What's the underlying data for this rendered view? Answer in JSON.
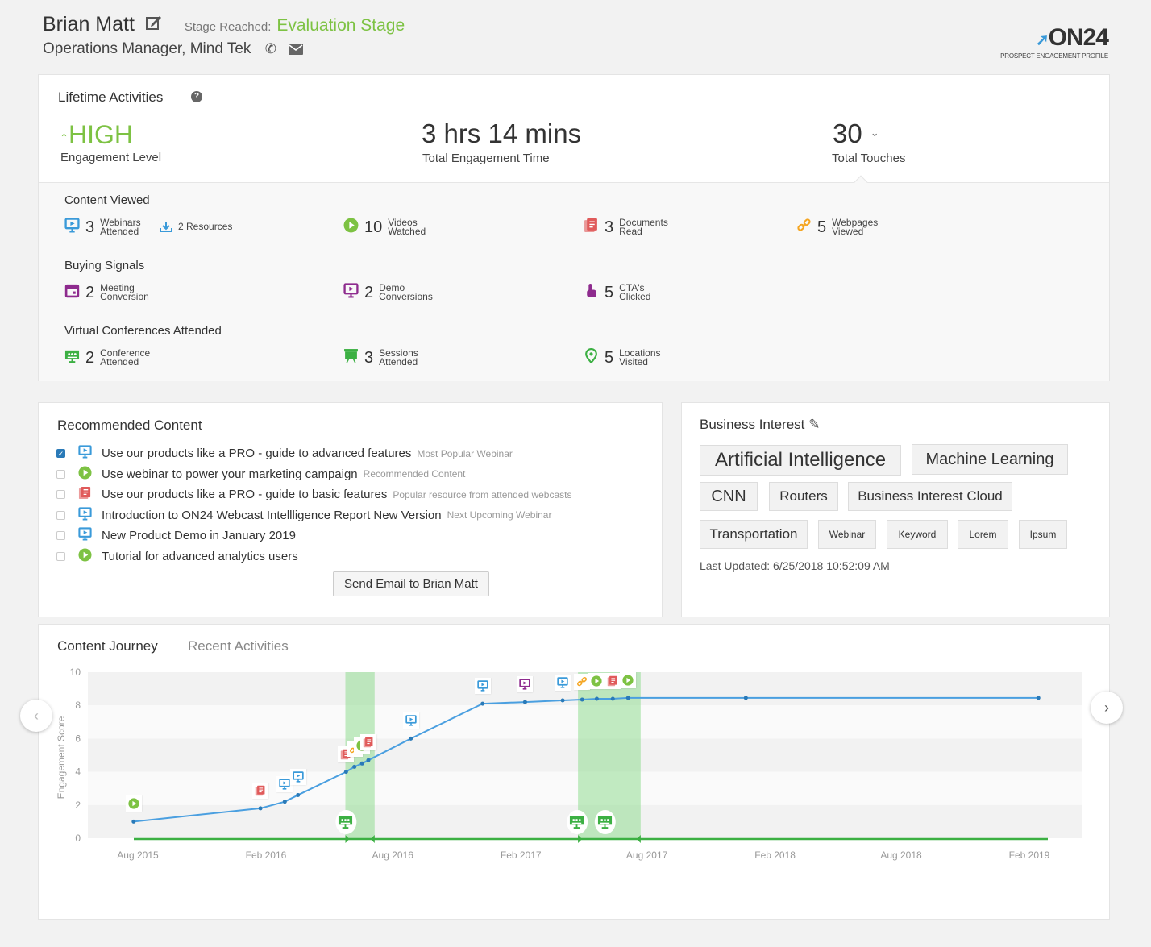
{
  "header": {
    "name": "Brian Matt",
    "stage_label": "Stage Reached:",
    "stage_value": "Evaluation Stage",
    "subtitle": "Operations Manager, Mind Tek",
    "logo_text": "ON24",
    "logo_sub": "PROSPECT ENGAGEMENT PROFILE"
  },
  "lifetime": {
    "title": "Lifetime Activities",
    "level": "HIGH",
    "level_label": "Engagement Level",
    "time": "3 hrs 14 mins",
    "time_label": "Total Engagement Time",
    "touches": "30",
    "touches_label": "Total Touches",
    "content_title": "Content Viewed",
    "buying_title": "Buying Signals",
    "virtual_title": "Virtual Conferences Attended",
    "content": [
      {
        "n": "3",
        "l1": "Webinars",
        "l2": "Attended",
        "icon": "webinar-icon"
      },
      {
        "n": "10",
        "l1": "Videos",
        "l2": "Watched",
        "icon": "video-icon"
      },
      {
        "n": "3",
        "l1": "Documents",
        "l2": "Read",
        "icon": "document-icon"
      },
      {
        "n": "5",
        "l1": "Webpages",
        "l2": "Viewed",
        "icon": "link-icon"
      }
    ],
    "resources": "2 Resources",
    "buying": [
      {
        "n": "2",
        "l1": "Meeting",
        "l2": "Conversion",
        "icon": "calendar-icon"
      },
      {
        "n": "2",
        "l1": "Demo",
        "l2": "Conversions",
        "icon": "demo-icon"
      },
      {
        "n": "5",
        "l1": "CTA's",
        "l2": "Clicked",
        "icon": "pointer-icon"
      }
    ],
    "virtual": [
      {
        "n": "2",
        "l1": "Conference",
        "l2": "Attended",
        "icon": "conference-icon"
      },
      {
        "n": "3",
        "l1": "Sessions",
        "l2": "Attended",
        "icon": "session-icon"
      },
      {
        "n": "5",
        "l1": "Locations",
        "l2": "Visited",
        "icon": "location-icon"
      }
    ]
  },
  "recommended": {
    "title": "Recommended Content",
    "items": [
      {
        "text": "Use our products like a PRO - guide to advanced features",
        "hint": "Most Popular Webinar",
        "icon": "webinar",
        "checked": true
      },
      {
        "text": "Use webinar to power your marketing campaign",
        "hint": "Recommended Content",
        "icon": "video",
        "checked": false
      },
      {
        "text": "Use our products like a PRO - guide to basic features",
        "hint": "Popular resource from attended webcasts",
        "icon": "document",
        "checked": false
      },
      {
        "text": "Introduction to ON24 Webcast Intellligence Report New Version",
        "hint": "Next Upcoming Webinar",
        "icon": "webinar",
        "checked": false
      },
      {
        "text": "New Product Demo in January 2019",
        "hint": "",
        "icon": "webinar",
        "checked": false
      },
      {
        "text": "Tutorial for advanced analytics users",
        "hint": "",
        "icon": "video",
        "checked": false
      }
    ],
    "button": "Send Email to Brian Matt"
  },
  "business": {
    "title": "Business Interest",
    "tags": [
      "Artificial Intelligence",
      "Machine Learning",
      "CNN",
      "Routers",
      "Business Interest Cloud",
      "Transportation",
      "Webinar",
      "Keyword",
      "Lorem",
      "Ipsum"
    ],
    "updated": "Last Updated: 6/25/2018 10:52:09 AM"
  },
  "journey": {
    "tabs": [
      "Content Journey",
      "Recent Activities"
    ],
    "active_tab": 0
  },
  "colors": {
    "green": "#7dc243",
    "blue": "#3a9ad9",
    "red": "#e05a5a",
    "orange": "#f5a623",
    "purple": "#8e2b8e",
    "conf": "#3cb043"
  },
  "chart_data": {
    "type": "line",
    "ylabel": "Engagement Score",
    "ylim": [
      0,
      10
    ],
    "yticks": [
      0,
      2,
      4,
      6,
      8,
      10
    ],
    "xticks": [
      {
        "label": "Aug 2015",
        "date": "2015-08-01"
      },
      {
        "label": "Feb 2016",
        "date": "2016-02-01"
      },
      {
        "label": "Aug 2016",
        "date": "2016-08-01"
      },
      {
        "label": "Feb 2017",
        "date": "2017-02-01"
      },
      {
        "label": "Aug 2017",
        "date": "2017-08-01"
      },
      {
        "label": "Feb 2018",
        "date": "2018-02-01"
      },
      {
        "label": "Aug 2018",
        "date": "2018-08-01"
      },
      {
        "label": "Feb 2019",
        "date": "2019-02-01"
      }
    ],
    "points": [
      {
        "date": "2015-07-26",
        "y": 1.0,
        "event": "video"
      },
      {
        "date": "2016-01-24",
        "y": 1.8,
        "event": "document"
      },
      {
        "date": "2016-02-28",
        "y": 2.2,
        "event": "webinar"
      },
      {
        "date": "2016-03-18",
        "y": 2.6,
        "event": "webinar"
      },
      {
        "date": "2016-05-26",
        "y": 4.0,
        "event": "document"
      },
      {
        "date": "2016-06-07",
        "y": 4.3,
        "event": "link"
      },
      {
        "date": "2016-06-18",
        "y": 4.5,
        "event": "video"
      },
      {
        "date": "2016-06-27",
        "y": 4.7,
        "event": "document"
      },
      {
        "date": "2016-08-27",
        "y": 6.0,
        "event": "webinar"
      },
      {
        "date": "2016-12-08",
        "y": 8.1,
        "event": "webinar"
      },
      {
        "date": "2017-02-07",
        "y": 8.2,
        "event": "demo"
      },
      {
        "date": "2017-04-02",
        "y": 8.3,
        "event": "webinar"
      },
      {
        "date": "2017-04-30",
        "y": 8.35,
        "event": "link"
      },
      {
        "date": "2017-05-21",
        "y": 8.4,
        "event": "video"
      },
      {
        "date": "2017-06-13",
        "y": 8.4,
        "event": "document"
      },
      {
        "date": "2017-07-05",
        "y": 8.45,
        "event": "video"
      },
      {
        "date": "2017-12-21",
        "y": 8.45,
        "event": ""
      },
      {
        "date": "2019-02-14",
        "y": 8.45,
        "event": ""
      }
    ],
    "conferences": [
      {
        "start": "2016-05-25",
        "end": "2016-07-06"
      },
      {
        "start": "2017-04-24",
        "end": "2017-07-23"
      }
    ],
    "conference_markers": [
      "2016-05-26",
      "2017-04-23",
      "2017-06-02"
    ]
  }
}
